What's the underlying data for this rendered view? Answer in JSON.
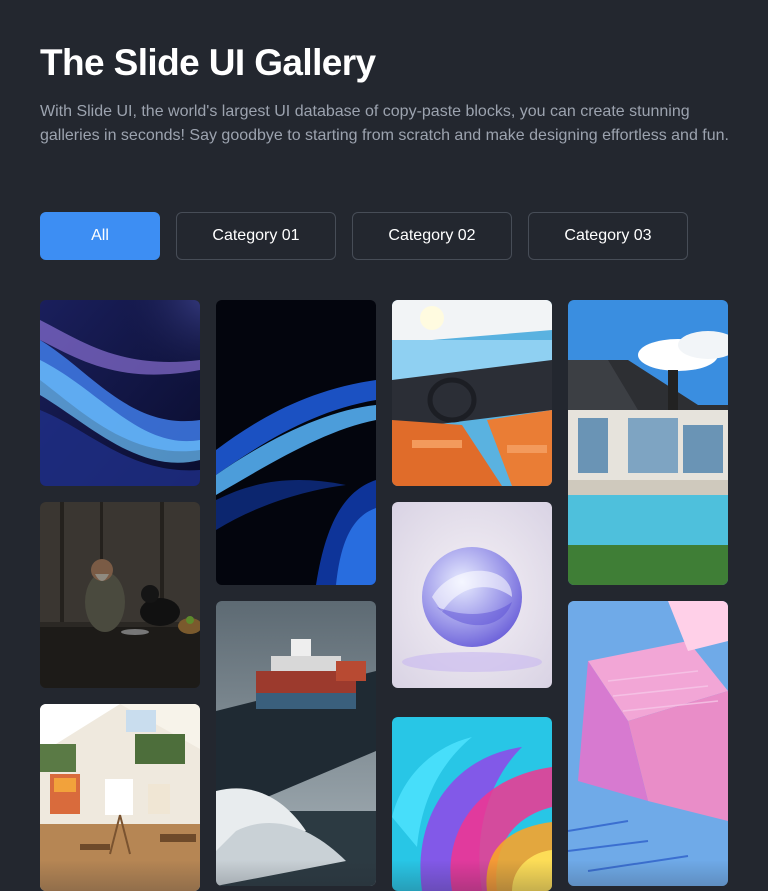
{
  "header": {
    "title": "The Slide UI Gallery",
    "description": "With Slide UI, the world's largest UI database of copy-paste blocks, you can create stunning galleries in seconds! Say goodbye to starting from scratch and make designing effortless and fun."
  },
  "filters": {
    "items": [
      {
        "label": "All",
        "active": true
      },
      {
        "label": "Category 01",
        "active": false
      },
      {
        "label": "Category 02",
        "active": false
      },
      {
        "label": "Category 03",
        "active": false
      }
    ]
  },
  "colors": {
    "background": "#23272f",
    "accent": "#3d8ef3",
    "button_border": "#474d57",
    "body_text": "#9ca3af"
  },
  "gallery": {
    "images": [
      {
        "name": "abstract-blue-waves"
      },
      {
        "name": "man-with-dog"
      },
      {
        "name": "art-studio"
      },
      {
        "name": "dark-blue-swirl"
      },
      {
        "name": "cargo-ship"
      },
      {
        "name": "car-interior"
      },
      {
        "name": "glass-sphere"
      },
      {
        "name": "rainbow-swirl"
      },
      {
        "name": "modern-house-pool"
      },
      {
        "name": "circuit-chip"
      }
    ]
  }
}
